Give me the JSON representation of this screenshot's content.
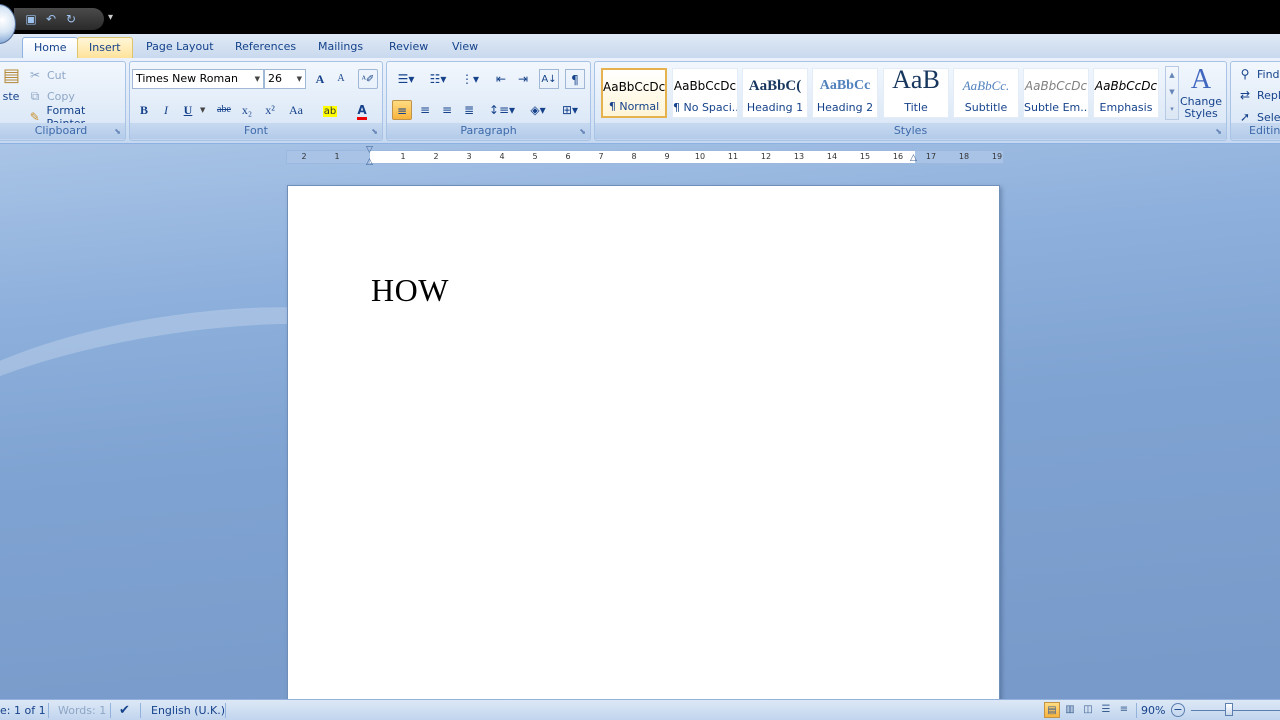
{
  "quick_access": {
    "save_icon": "save-icon",
    "undo_icon": "undo-icon",
    "redo_icon": "redo-icon"
  },
  "tabs": [
    {
      "label": "Home",
      "active": true
    },
    {
      "label": "Insert",
      "hot": true
    },
    {
      "label": "Page Layout"
    },
    {
      "label": "References"
    },
    {
      "label": "Mailings"
    },
    {
      "label": "Review"
    },
    {
      "label": "View"
    }
  ],
  "clipboard": {
    "paste_label": "ste",
    "cut_label": "Cut",
    "copy_label": "Copy",
    "format_painter_label": "Format Painter",
    "group_label": "Clipboard"
  },
  "font": {
    "family": "Times New Roman",
    "size": "26",
    "group_label": "Font",
    "bold": "B",
    "italic": "I",
    "underline": "U",
    "strike": "abe",
    "subscript": "x₂",
    "superscript": "x²",
    "change_case": "Aa",
    "grow": "A",
    "shrink": "A"
  },
  "paragraph": {
    "group_label": "Paragraph",
    "pilcrow": "¶"
  },
  "styles": {
    "group_label": "Styles",
    "items": [
      {
        "sample": "AaBbCcDc",
        "name": "¶ Normal",
        "selected": true
      },
      {
        "sample": "AaBbCcDc",
        "name": "¶ No Spaci..."
      },
      {
        "sample": "AaBbC(",
        "name": "Heading 1"
      },
      {
        "sample": "AaBbCc",
        "name": "Heading 2"
      },
      {
        "sample": "AaB",
        "name": "Title"
      },
      {
        "sample": "AaBbCc.",
        "name": "Subtitle"
      },
      {
        "sample": "AaBbCcDc",
        "name": "Subtle Em..."
      },
      {
        "sample": "AaBbCcDc",
        "name": "Emphasis"
      }
    ],
    "change_styles_line1": "Change",
    "change_styles_line2": "Styles"
  },
  "editing": {
    "group_label": "Editing",
    "find_label": "Find",
    "replace_label": "Repla",
    "select_label": "Selec"
  },
  "ruler": {
    "labels": [
      "2",
      "1",
      "1",
      "2",
      "3",
      "4",
      "5",
      "6",
      "7",
      "8",
      "9",
      "10",
      "11",
      "12",
      "13",
      "14",
      "15",
      "16",
      "17",
      "18",
      "19"
    ]
  },
  "document": {
    "text": "HOW"
  },
  "status": {
    "page": "e: 1 of 1",
    "words": "Words: 1",
    "language": "English (U.K.)",
    "zoom": "90%",
    "zoom_minus": "−",
    "zoom_fraction": 0.9
  }
}
